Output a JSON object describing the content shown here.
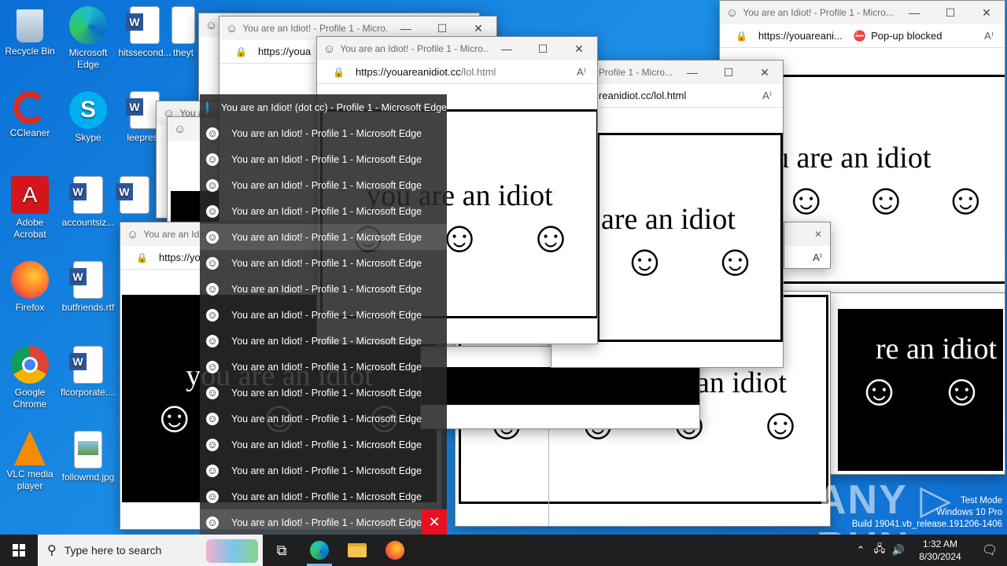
{
  "desktop_icons": [
    {
      "label": "Recycle Bin",
      "icon": "recycle-bin-icon"
    },
    {
      "label": "Microsoft Edge",
      "icon": "edge-icon"
    },
    {
      "label": "hitssecond...",
      "icon": "word-doc-icon"
    },
    {
      "label": "theyt",
      "icon": "word-doc-icon"
    },
    {
      "label": "CCleaner",
      "icon": "ccleaner-icon"
    },
    {
      "label": "Skype",
      "icon": "skype-icon"
    },
    {
      "label": "leepress",
      "icon": "word-doc-icon"
    },
    {
      "label": "Adobe Acrobat",
      "icon": "acrobat-icon"
    },
    {
      "label": "accountsiz...",
      "icon": "word-doc-icon"
    },
    {
      "label": "Firefox",
      "icon": "firefox-icon"
    },
    {
      "label": "butfriends.rtf",
      "icon": "word-doc-icon"
    },
    {
      "label": "Google Chrome",
      "icon": "chrome-icon"
    },
    {
      "label": "flcorporate....",
      "icon": "word-doc-icon"
    },
    {
      "label": "VLC media player",
      "icon": "vlc-icon"
    },
    {
      "label": "followmd.jpg",
      "icon": "image-file-icon"
    }
  ],
  "window_title": "You are an Idiot! - Profile 1 - Micro...",
  "window_title_short": "You are an Idio",
  "window_title_mid": "Profile 1 - Micro...",
  "url_host": "https://youareanidiot.cc",
  "url_path": "/lol.html",
  "url_partial_a": "https://youa",
  "url_partial_b": "reanidiot.cc/lol.html",
  "url_partial_c": "https://youareani...",
  "url_partial_d": "https://yo",
  "popup_blocked": "Pop-up blocked",
  "idiot_text": "you are an idiot",
  "idiot_text_partial": "u are an idiot",
  "idiot_text_partial2": "are an idiot",
  "idiot_text_partial3": "re an idiot",
  "idiot_text_partial4": "an idiot",
  "jumplist": {
    "first": "You are an Idiot! (dot cc) - Profile 1 - Microsoft Edge",
    "item": "You are an Idiot! - Profile 1 - Microsoft Edge",
    "count": 16,
    "close": "✕"
  },
  "watermark": {
    "line1": "Test Mode",
    "line2": "Windows 10 Pro",
    "line3": "Build 19041.vb_release.191206-1406",
    "brand": "ANY ▷ RUN"
  },
  "taskbar": {
    "search_placeholder": "Type here to search",
    "time": "1:32 AM",
    "date": "8/30/2024"
  }
}
